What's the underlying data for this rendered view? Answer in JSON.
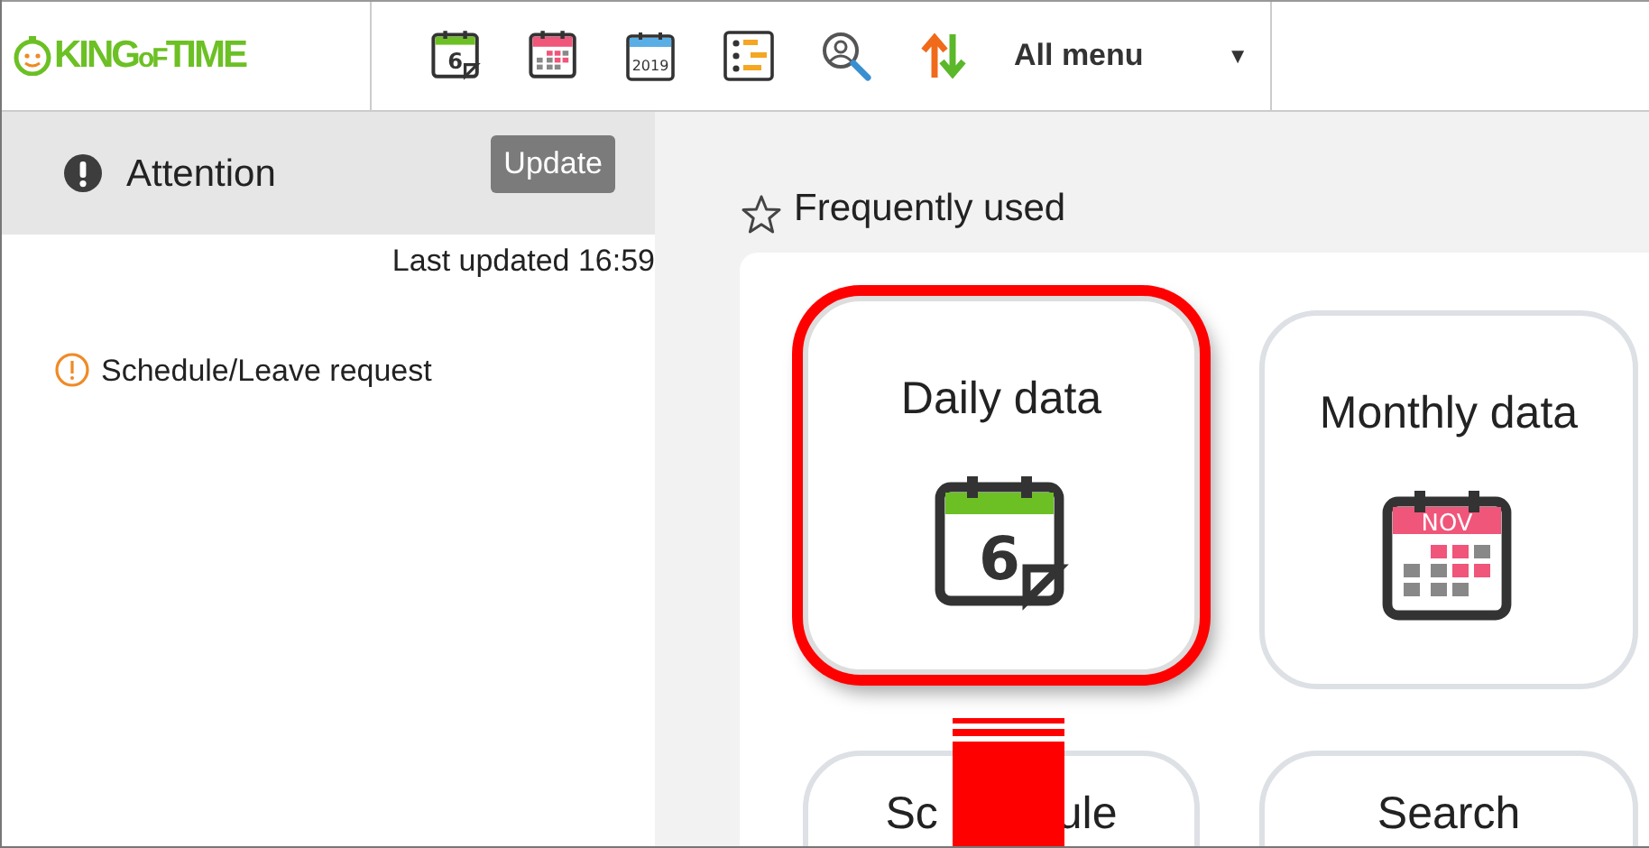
{
  "header": {
    "logo": {
      "text_start": "KING",
      "text_mid": "oF",
      "text_end": "TIME"
    },
    "toolbar": [
      {
        "kind": "daily",
        "text": "6"
      },
      {
        "kind": "monthly"
      },
      {
        "kind": "year",
        "text": "2019"
      },
      {
        "kind": "list"
      },
      {
        "kind": "search"
      },
      {
        "kind": "sort"
      }
    ],
    "menu": {
      "label": "All menu",
      "caret": "▼"
    }
  },
  "sidebar": {
    "title": "Attention",
    "update_button": "Update",
    "last_updated": "Last updated 16:59",
    "alerts": [
      {
        "label": "Schedule/Leave request"
      }
    ]
  },
  "main": {
    "section_title": "Frequently used",
    "tiles": [
      {
        "kind": "daily",
        "label": "Daily data",
        "highlighted": true,
        "icon_text": "6"
      },
      {
        "kind": "monthly",
        "label": "Monthly data",
        "highlighted": false,
        "icon_text": "NOV"
      },
      {
        "kind": "covered",
        "label_start": "Sc",
        "label_end": "ule",
        "highlighted": false
      },
      {
        "kind": "plain",
        "label": "Search",
        "highlighted": false
      }
    ]
  }
}
